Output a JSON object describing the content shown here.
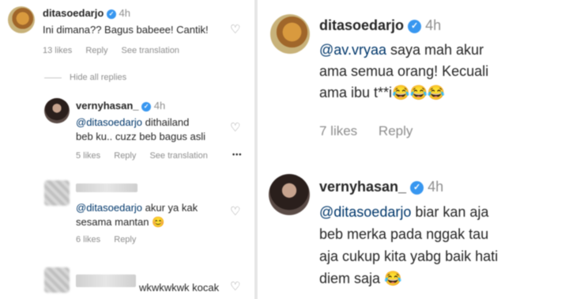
{
  "left": {
    "comment1": {
      "username": "ditasoedarjo",
      "time": "4h",
      "text": "Ini dimana?? Bagus babeee! Cantik!",
      "likes": "13 likes",
      "reply": "Reply",
      "see_translation": "See translation"
    },
    "hide_replies": "Hide all replies",
    "reply1": {
      "username": "vernyhasan_",
      "time": "4h",
      "mention": "@ditasoedarjo",
      "text_rest": " dithailand",
      "text_line2": "beb ku.. cuzz beb bagus asli",
      "likes": "5 likes",
      "reply": "Reply",
      "see_translation": "See translation",
      "more": "•••"
    },
    "reply2": {
      "mention": "@ditasoedarjo",
      "text_rest": " akur ya kak",
      "text_line2": "sesama mantan",
      "emoji": "😊",
      "likes": "6 likes",
      "reply": "Reply"
    },
    "reply3": {
      "text": "wkwkwkwk kocak"
    }
  },
  "right": {
    "comment1": {
      "username": "ditasoedarjo",
      "time": "4h",
      "mention": "@av.vryaa",
      "text_line1_rest": " saya mah akur",
      "text_line2": "ama semua orang! Kecuali",
      "text_line3": "ama ibu t**i😂😂😂",
      "likes": "7 likes",
      "reply": "Reply"
    },
    "comment2": {
      "username": "vernyhasan_",
      "time": "4h",
      "mention": "@ditasoedarjo",
      "text_line1_rest": " biar kan aja",
      "text_line2": "beb merka pada nggak tau",
      "text_line3": "aja cukup kita yabg baik hati",
      "text_line4": "diem saja 😂"
    }
  },
  "colors": {
    "verified": "#3897f0",
    "mention": "#00376b",
    "muted": "#8e8e8e",
    "text": "#262626"
  },
  "icons": [
    "verified-badge-icon",
    "heart-icon",
    "more-options-icon"
  ]
}
